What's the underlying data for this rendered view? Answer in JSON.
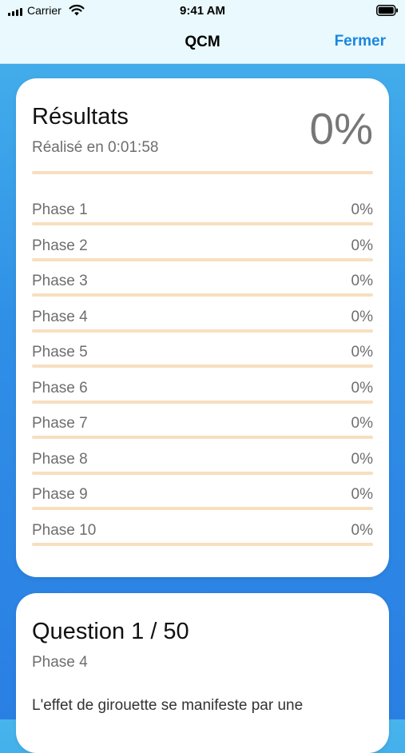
{
  "status_bar": {
    "carrier": "Carrier",
    "time": "9:41 AM",
    "icons": [
      "signal-icon",
      "wifi-icon",
      "battery-icon"
    ]
  },
  "nav": {
    "title": "QCM",
    "close_label": "Fermer"
  },
  "results": {
    "title": "Résultats",
    "duration": "Réalisé en 0:01:58",
    "score": "0%",
    "score_fraction": 0,
    "phases": [
      {
        "label": "Phase 1",
        "value": "0%",
        "fraction": 0
      },
      {
        "label": "Phase 2",
        "value": "0%",
        "fraction": 0
      },
      {
        "label": "Phase 3",
        "value": "0%",
        "fraction": 0
      },
      {
        "label": "Phase 4",
        "value": "0%",
        "fraction": 0
      },
      {
        "label": "Phase 5",
        "value": "0%",
        "fraction": 0
      },
      {
        "label": "Phase 6",
        "value": "0%",
        "fraction": 0
      },
      {
        "label": "Phase 7",
        "value": "0%",
        "fraction": 0
      },
      {
        "label": "Phase 8",
        "value": "0%",
        "fraction": 0
      },
      {
        "label": "Phase 9",
        "value": "0%",
        "fraction": 0
      },
      {
        "label": "Phase 10",
        "value": "0%",
        "fraction": 0
      }
    ]
  },
  "question": {
    "title": "Question 1 / 50",
    "phase": "Phase 4",
    "text": "L'effet de girouette se manifeste par une"
  },
  "colors": {
    "accent": "#1a86e0",
    "bar_track": "#f7dfbf",
    "bar_fill": "#f0a33a",
    "background_top": "#47b4ec",
    "background_bottom": "#2a7fe3"
  }
}
